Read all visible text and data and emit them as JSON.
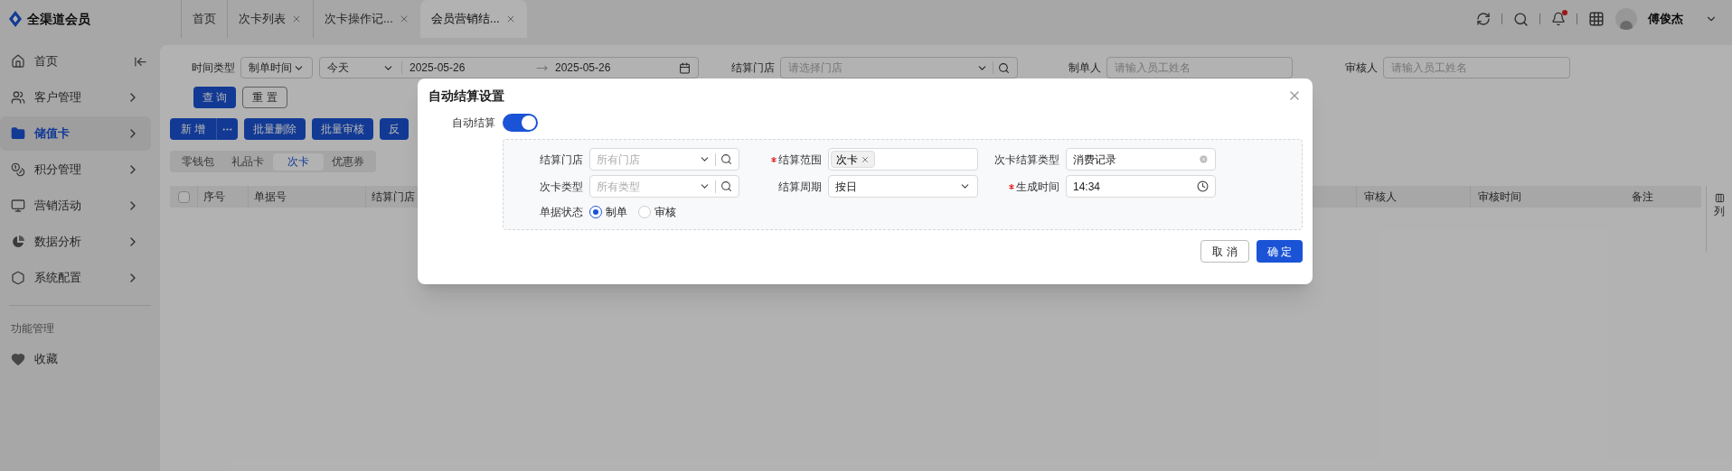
{
  "app": {
    "name": "全渠道会员"
  },
  "tabs": [
    {
      "label": "首页",
      "closable": false,
      "selected": false
    },
    {
      "label": "次卡列表",
      "closable": true,
      "selected": false
    },
    {
      "label": "次卡操作记...",
      "closable": true,
      "selected": false
    },
    {
      "label": "会员营销结...",
      "closable": true,
      "selected": true
    }
  ],
  "header": {
    "user": "傅俊杰",
    "notification": true
  },
  "sidebar": {
    "items": [
      {
        "label": "首页",
        "selected": false,
        "expandable": false
      },
      {
        "label": "客户管理",
        "selected": false,
        "expandable": true
      },
      {
        "label": "储值卡",
        "selected": true,
        "expandable": true
      },
      {
        "label": "积分管理",
        "selected": false,
        "expandable": true
      },
      {
        "label": "营销活动",
        "selected": false,
        "expandable": true
      },
      {
        "label": "数据分析",
        "selected": false,
        "expandable": true
      },
      {
        "label": "系统配置",
        "selected": false,
        "expandable": true
      }
    ],
    "section": "功能管理",
    "favorites": [
      {
        "label": "收藏"
      }
    ]
  },
  "filters": {
    "time_type": {
      "label": "时间类型",
      "value": "制单时间"
    },
    "date_range": {
      "preset": "今天",
      "start": "2025-05-26",
      "end": "2025-05-26"
    },
    "store": {
      "label": "结算门店",
      "placeholder": "请选择门店"
    },
    "maker": {
      "label": "制单人",
      "placeholder": "请输入员工姓名"
    },
    "reviewer": {
      "label": "审核人",
      "placeholder": "请输入员工姓名"
    },
    "buttons": [
      {
        "label": "查 询",
        "kind": "primary"
      },
      {
        "label": "重 置",
        "kind": "default"
      }
    ]
  },
  "actions": [
    {
      "label": "新 增",
      "kind": "split"
    },
    {
      "label": "批量删除",
      "kind": "plain"
    },
    {
      "label": "批量审核",
      "kind": "plain"
    },
    {
      "label": "反",
      "kind": "plain"
    }
  ],
  "segments": [
    {
      "label": "零钱包",
      "selected": false
    },
    {
      "label": "礼品卡",
      "selected": false
    },
    {
      "label": "次卡",
      "selected": true
    },
    {
      "label": "优惠券",
      "selected": false
    }
  ],
  "table": {
    "columns": [
      {
        "label": "序号"
      },
      {
        "label": "单据号"
      },
      {
        "label": "结算门店"
      },
      {
        "label": "审核人"
      },
      {
        "label": "审核时间"
      },
      {
        "label": "备注"
      }
    ],
    "column_settings": "列",
    "select_all": {
      "checked": false
    }
  },
  "dialog": {
    "title": "自动结算设置",
    "auto_settle": {
      "label": "自动结算",
      "on": true
    },
    "fields": [
      {
        "label": "结算门店",
        "required": false,
        "kind": "search-select",
        "placeholder": "所有门店"
      },
      {
        "label": "结算范围",
        "required": true,
        "kind": "tags",
        "tags": [
          "次卡"
        ]
      },
      {
        "label": "次卡结算类型",
        "required": false,
        "kind": "clearable",
        "value": "消费记录"
      },
      {
        "label": "次卡类型",
        "required": false,
        "kind": "search-select",
        "placeholder": "所有类型"
      },
      {
        "label": "结算周期",
        "required": false,
        "kind": "select",
        "value": "按日"
      },
      {
        "label": "生成时间",
        "required": true,
        "kind": "time",
        "value": "14:34"
      }
    ],
    "status": {
      "label": "单据状态",
      "options": [
        {
          "label": "制单",
          "selected": true
        },
        {
          "label": "审核",
          "selected": false
        }
      ]
    },
    "buttons": [
      {
        "label": "取 消",
        "kind": "default"
      },
      {
        "label": "确 定",
        "kind": "primary"
      }
    ]
  }
}
